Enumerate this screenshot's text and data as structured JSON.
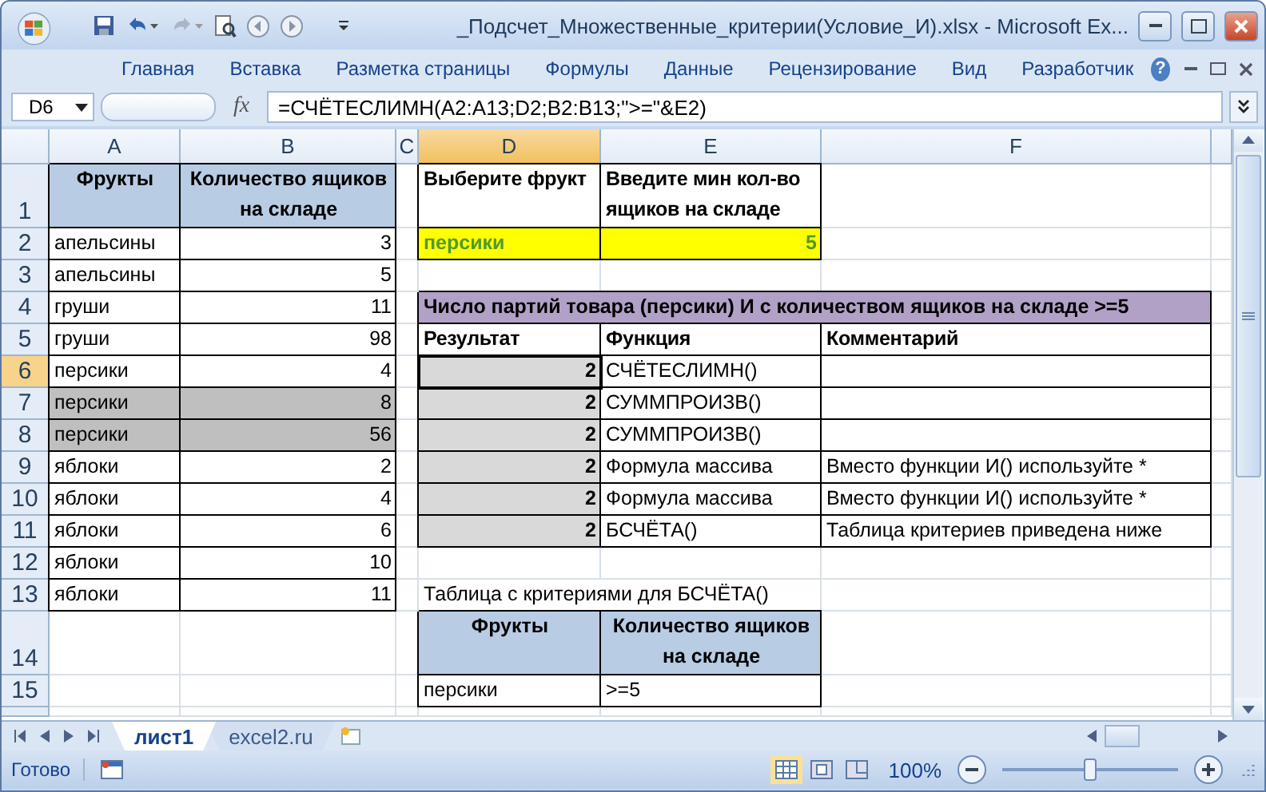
{
  "window": {
    "title": "_Подсчет_Множественные_критерии(Условие_И).xlsx - Microsoft Ex..."
  },
  "ribbon_tabs": [
    "Главная",
    "Вставка",
    "Разметка страницы",
    "Формулы",
    "Данные",
    "Рецензирование",
    "Вид",
    "Разработчик"
  ],
  "help_button": "?",
  "formula_bar": {
    "name_box": "D6",
    "function_button": "fx",
    "formula": "=СЧЁТЕСЛИМН(A2:A13;D2;B2:B13;\">=\"&E2)"
  },
  "sheet": {
    "columns": [
      {
        "label": "A",
        "selected": false
      },
      {
        "label": "B",
        "selected": false
      },
      {
        "label": "C",
        "selected": false
      },
      {
        "label": "D",
        "selected": true
      },
      {
        "label": "E",
        "selected": false
      },
      {
        "label": "F",
        "selected": false
      }
    ],
    "rows": [
      {
        "number": "1",
        "selected": false,
        "cells": {
          "a": {
            "text": "Фрукты",
            "kind": "header"
          },
          "b": {
            "text": "Количество ящиков на складе",
            "kind": "header"
          },
          "d": {
            "text": "Выберите фрукт",
            "kind": "label"
          },
          "e": {
            "text": "Введите мин кол-во ящиков на складе",
            "kind": "label"
          }
        }
      },
      {
        "number": "2",
        "selected": false,
        "cells": {
          "a": {
            "text": "апельсины",
            "kind": "bordered"
          },
          "b": {
            "text": "3",
            "kind": "number"
          },
          "d": {
            "text": "персики",
            "kind": "input"
          },
          "e": {
            "text": "5",
            "kind": "input-number"
          }
        }
      },
      {
        "number": "3",
        "selected": false,
        "cells": {
          "a": {
            "text": "апельсины",
            "kind": "bordered"
          },
          "b": {
            "text": "5",
            "kind": "number"
          }
        }
      },
      {
        "number": "4",
        "selected": false,
        "cells": {
          "a": {
            "text": "груши",
            "kind": "bordered"
          },
          "b": {
            "text": "11",
            "kind": "number"
          },
          "d": {
            "text": "Число партий товара (персики) И с количеством ящиков на складе >=5",
            "kind": "title"
          }
        }
      },
      {
        "number": "5",
        "selected": false,
        "cells": {
          "a": {
            "text": "груши",
            "kind": "bordered"
          },
          "b": {
            "text": "98",
            "kind": "number"
          },
          "d": {
            "text": "Результат",
            "kind": "label"
          },
          "e": {
            "text": "Функция",
            "kind": "label"
          },
          "f": {
            "text": "Комментарий",
            "kind": "label"
          }
        }
      },
      {
        "number": "6",
        "selected": true,
        "cells": {
          "a": {
            "text": "персики",
            "kind": "bordered"
          },
          "b": {
            "text": "4",
            "kind": "number"
          },
          "d": {
            "text": "2",
            "kind": "result"
          },
          "e": {
            "text": "СЧЁТЕСЛИМН()",
            "kind": "bordered"
          },
          "f": {
            "kind": "bordered"
          }
        }
      },
      {
        "number": "7",
        "selected": false,
        "cells": {
          "a": {
            "text": "персики",
            "kind": "highlight"
          },
          "b": {
            "text": "8",
            "kind": "highlight-number"
          },
          "d": {
            "text": "2",
            "kind": "result"
          },
          "e": {
            "text": "СУММПРОИЗВ()",
            "kind": "bordered"
          },
          "f": {
            "kind": "bordered"
          }
        }
      },
      {
        "number": "8",
        "selected": false,
        "cells": {
          "a": {
            "text": "персики",
            "kind": "highlight"
          },
          "b": {
            "text": "56",
            "kind": "highlight-number"
          },
          "d": {
            "text": "2",
            "kind": "result"
          },
          "e": {
            "text": "СУММПРОИЗВ()",
            "kind": "bordered"
          },
          "f": {
            "kind": "bordered"
          }
        }
      },
      {
        "number": "9",
        "selected": false,
        "cells": {
          "a": {
            "text": "яблоки",
            "kind": "bordered"
          },
          "b": {
            "text": "2",
            "kind": "number"
          },
          "d": {
            "text": "2",
            "kind": "result"
          },
          "e": {
            "text": "Формула массива",
            "kind": "bordered"
          },
          "f": {
            "text": "Вместо функции И() используйте *",
            "kind": "bordered"
          }
        }
      },
      {
        "number": "10",
        "selected": false,
        "cells": {
          "a": {
            "text": "яблоки",
            "kind": "bordered"
          },
          "b": {
            "text": "4",
            "kind": "number"
          },
          "d": {
            "text": "2",
            "kind": "result"
          },
          "e": {
            "text": "Формула массива",
            "kind": "bordered"
          },
          "f": {
            "text": "Вместо функции И() используйте *",
            "kind": "bordered"
          }
        }
      },
      {
        "number": "11",
        "selected": false,
        "cells": {
          "a": {
            "text": "яблоки",
            "kind": "bordered"
          },
          "b": {
            "text": "6",
            "kind": "number"
          },
          "d": {
            "text": "2",
            "kind": "result"
          },
          "e": {
            "text": "БСЧЁТА()",
            "kind": "bordered"
          },
          "f": {
            "text": "Таблица критериев приведена ниже",
            "kind": "bordered"
          }
        }
      },
      {
        "number": "12",
        "selected": false,
        "cells": {
          "a": {
            "text": "яблоки",
            "kind": "bordered"
          },
          "b": {
            "text": "10",
            "kind": "number"
          }
        }
      },
      {
        "number": "13",
        "selected": false,
        "cells": {
          "a": {
            "text": "яблоки",
            "kind": "bordered"
          },
          "b": {
            "text": "11",
            "kind": "number"
          },
          "d": {
            "text": "Таблица с критериями для БСЧЁТА()",
            "kind": "note"
          }
        }
      },
      {
        "number": "14",
        "selected": false,
        "cells": {
          "d": {
            "text": "Фрукты",
            "kind": "header"
          },
          "e": {
            "text": "Количество ящиков на складе",
            "kind": "header"
          }
        }
      },
      {
        "number": "15",
        "selected": false,
        "cells": {
          "d": {
            "text": "персики",
            "kind": "bordered"
          },
          "e": {
            "text": ">=5",
            "kind": "bordered"
          }
        }
      }
    ]
  },
  "sheet_tabs": [
    {
      "label": "лист1",
      "selected": true
    },
    {
      "label": "excel2.ru",
      "selected": false
    }
  ],
  "status_bar": {
    "status": "Готово",
    "zoom": "100%",
    "zoom_slider": {
      "level": 0.5
    }
  }
}
